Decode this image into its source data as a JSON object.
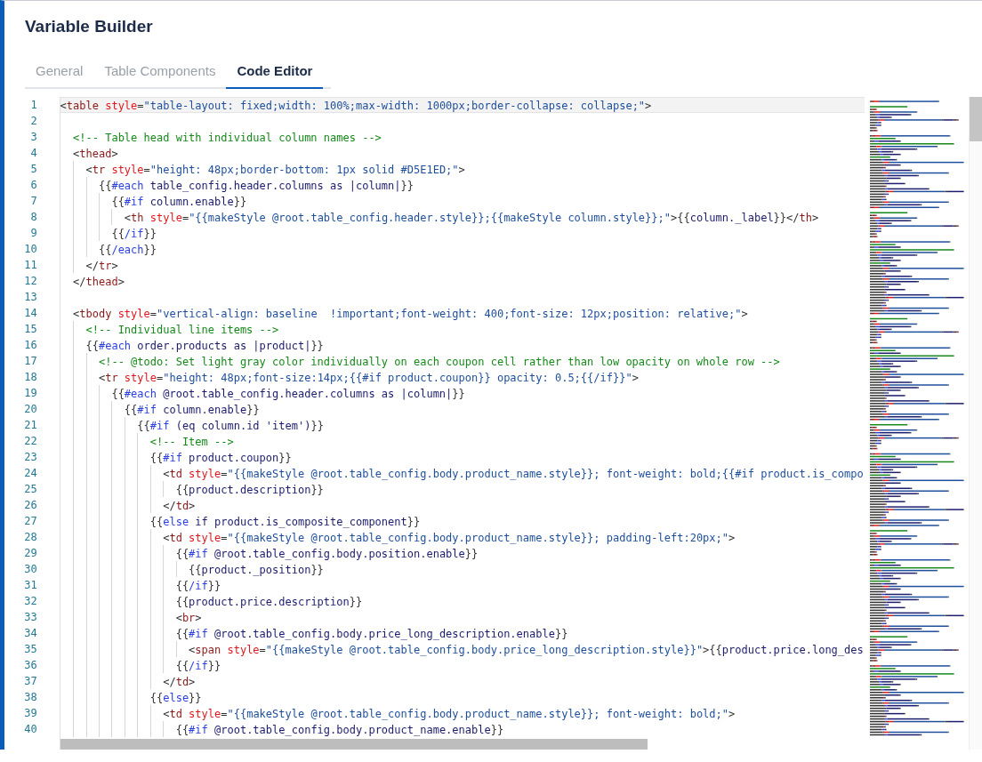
{
  "title": "Variable Builder",
  "tabs": [
    {
      "label": "General",
      "selected": false
    },
    {
      "label": "Table Components",
      "selected": false
    },
    {
      "label": "Code Editor",
      "selected": true
    }
  ],
  "editor": {
    "lines": [
      {
        "number": "1",
        "current": true,
        "tokens": [
          {
            "kind": "p",
            "text": "<"
          },
          {
            "kind": "tag",
            "text": "table"
          },
          {
            "kind": "attr",
            "text": " style"
          },
          {
            "kind": "p",
            "text": "="
          },
          {
            "kind": "str",
            "text": "\"table-layout: fixed;width: 100%;max-width: 1000px;border-collapse: collapse;\""
          },
          {
            "kind": "p",
            "text": ">"
          }
        ]
      },
      {
        "number": "2",
        "current": false
      },
      {
        "number": "3",
        "current": false,
        "tokens": [
          {
            "kind": "cm",
            "text": "  <!-- Table head with individual column names -->"
          }
        ]
      },
      {
        "number": "4",
        "current": false,
        "tokens": [
          {
            "kind": "p",
            "text": "  <"
          },
          {
            "kind": "tag",
            "text": "thead"
          },
          {
            "kind": "p",
            "text": ">"
          }
        ]
      },
      {
        "number": "5",
        "current": false,
        "tokens": [
          {
            "kind": "p",
            "text": "    <"
          },
          {
            "kind": "tag",
            "text": "tr"
          },
          {
            "kind": "attr",
            "text": " style"
          },
          {
            "kind": "p",
            "text": "="
          },
          {
            "kind": "str",
            "text": "\"height: 48px;border-bottom: 1px solid #D5E1ED;\""
          },
          {
            "kind": "p",
            "text": ">"
          }
        ]
      },
      {
        "number": "6",
        "current": false,
        "tokens": [
          {
            "kind": "p",
            "text": "      {{"
          },
          {
            "kind": "kw",
            "text": "#each"
          },
          {
            "kind": "hb",
            "text": " table_config.header.columns as |column|"
          },
          {
            "kind": "p",
            "text": "}}"
          }
        ]
      },
      {
        "number": "7",
        "current": false,
        "tokens": [
          {
            "kind": "p",
            "text": "        {{"
          },
          {
            "kind": "kw",
            "text": "#if"
          },
          {
            "kind": "hb",
            "text": " column.enable"
          },
          {
            "kind": "p",
            "text": "}}"
          }
        ]
      },
      {
        "number": "8",
        "current": false,
        "tokens": [
          {
            "kind": "p",
            "text": "          <"
          },
          {
            "kind": "tag",
            "text": "th"
          },
          {
            "kind": "attr",
            "text": " style"
          },
          {
            "kind": "p",
            "text": "="
          },
          {
            "kind": "str",
            "text": "\"{{makeStyle @root.table_config.header.style}};{{makeStyle column.style}};\""
          },
          {
            "kind": "p",
            "text": ">{{"
          },
          {
            "kind": "hb",
            "text": "column._label"
          },
          {
            "kind": "p",
            "text": "}}</"
          },
          {
            "kind": "tag",
            "text": "th"
          },
          {
            "kind": "p",
            "text": ">"
          }
        ]
      },
      {
        "number": "9",
        "current": false,
        "tokens": [
          {
            "kind": "p",
            "text": "        {{"
          },
          {
            "kind": "kw",
            "text": "/if"
          },
          {
            "kind": "p",
            "text": "}}"
          }
        ]
      },
      {
        "number": "10",
        "current": false,
        "tokens": [
          {
            "kind": "p",
            "text": "      {{"
          },
          {
            "kind": "kw",
            "text": "/each"
          },
          {
            "kind": "p",
            "text": "}}"
          }
        ]
      },
      {
        "number": "11",
        "current": false,
        "tokens": [
          {
            "kind": "p",
            "text": "    </"
          },
          {
            "kind": "tag",
            "text": "tr"
          },
          {
            "kind": "p",
            "text": ">"
          }
        ]
      },
      {
        "number": "12",
        "current": false,
        "tokens": [
          {
            "kind": "p",
            "text": "  </"
          },
          {
            "kind": "tag",
            "text": "thead"
          },
          {
            "kind": "p",
            "text": ">"
          }
        ]
      },
      {
        "number": "13",
        "current": false
      },
      {
        "number": "14",
        "current": false,
        "tokens": [
          {
            "kind": "p",
            "text": "  <"
          },
          {
            "kind": "tag",
            "text": "tbody"
          },
          {
            "kind": "attr",
            "text": " style"
          },
          {
            "kind": "p",
            "text": "="
          },
          {
            "kind": "str",
            "text": "\"vertical-align: baseline  !important;font-weight: 400;font-size: 12px;position: relative;\""
          },
          {
            "kind": "p",
            "text": ">"
          }
        ]
      },
      {
        "number": "15",
        "current": false,
        "tokens": [
          {
            "kind": "cm",
            "text": "    <!-- Individual line items -->"
          }
        ]
      },
      {
        "number": "16",
        "current": false,
        "tokens": [
          {
            "kind": "p",
            "text": "    {{"
          },
          {
            "kind": "kw",
            "text": "#each"
          },
          {
            "kind": "hb",
            "text": " order.products as |product|"
          },
          {
            "kind": "p",
            "text": "}}"
          }
        ]
      },
      {
        "number": "17",
        "current": false,
        "tokens": [
          {
            "kind": "cm",
            "text": "      <!-- @todo: Set light gray color individually on each coupon cell rather than low opacity on whole row -->"
          }
        ]
      },
      {
        "number": "18",
        "current": false,
        "tokens": [
          {
            "kind": "p",
            "text": "      <"
          },
          {
            "kind": "tag",
            "text": "tr"
          },
          {
            "kind": "attr",
            "text": " style"
          },
          {
            "kind": "p",
            "text": "="
          },
          {
            "kind": "str",
            "text": "\"height: 48px;font-size:14px;{{#if product.coupon}} opacity: 0.5;{{/if}}\""
          },
          {
            "kind": "p",
            "text": ">"
          }
        ]
      },
      {
        "number": "19",
        "current": false,
        "tokens": [
          {
            "kind": "p",
            "text": "        {{"
          },
          {
            "kind": "kw",
            "text": "#each"
          },
          {
            "kind": "hb",
            "text": " @root.table_config.header.columns as |column|"
          },
          {
            "kind": "p",
            "text": "}}"
          }
        ]
      },
      {
        "number": "20",
        "current": false,
        "tokens": [
          {
            "kind": "p",
            "text": "          {{"
          },
          {
            "kind": "kw",
            "text": "#if"
          },
          {
            "kind": "hb",
            "text": " column.enable"
          },
          {
            "kind": "p",
            "text": "}}"
          }
        ]
      },
      {
        "number": "21",
        "current": false,
        "tokens": [
          {
            "kind": "p",
            "text": "            {{"
          },
          {
            "kind": "kw",
            "text": "#if"
          },
          {
            "kind": "hb",
            "text": " (eq column.id 'item')"
          },
          {
            "kind": "p",
            "text": "}}"
          }
        ]
      },
      {
        "number": "22",
        "current": false,
        "tokens": [
          {
            "kind": "cm",
            "text": "              <!-- Item -->"
          }
        ]
      },
      {
        "number": "23",
        "current": false,
        "tokens": [
          {
            "kind": "p",
            "text": "              {{"
          },
          {
            "kind": "kw",
            "text": "#if"
          },
          {
            "kind": "hb",
            "text": " product.coupon"
          },
          {
            "kind": "p",
            "text": "}}"
          }
        ]
      },
      {
        "number": "24",
        "current": false,
        "tokens": [
          {
            "kind": "p",
            "text": "                <"
          },
          {
            "kind": "tag",
            "text": "td"
          },
          {
            "kind": "attr",
            "text": " style"
          },
          {
            "kind": "p",
            "text": "="
          },
          {
            "kind": "str",
            "text": "\"{{makeStyle @root.table_config.body.product_name.style}}; font-weight: bold;{{#if product.is_compo"
          }
        ]
      },
      {
        "number": "25",
        "current": false,
        "tokens": [
          {
            "kind": "p",
            "text": "                  {{"
          },
          {
            "kind": "hb",
            "text": "product.description"
          },
          {
            "kind": "p",
            "text": "}}"
          }
        ]
      },
      {
        "number": "26",
        "current": false,
        "tokens": [
          {
            "kind": "p",
            "text": "                </"
          },
          {
            "kind": "tag",
            "text": "td"
          },
          {
            "kind": "p",
            "text": ">"
          }
        ]
      },
      {
        "number": "27",
        "current": false,
        "tokens": [
          {
            "kind": "p",
            "text": "              {{"
          },
          {
            "kind": "kw",
            "text": "else"
          },
          {
            "kind": "hb",
            "text": " if product.is_composite_component"
          },
          {
            "kind": "p",
            "text": "}}"
          }
        ]
      },
      {
        "number": "28",
        "current": false,
        "tokens": [
          {
            "kind": "p",
            "text": "                <"
          },
          {
            "kind": "tag",
            "text": "td"
          },
          {
            "kind": "attr",
            "text": " style"
          },
          {
            "kind": "p",
            "text": "="
          },
          {
            "kind": "str",
            "text": "\"{{makeStyle @root.table_config.body.product_name.style}}; padding-left:20px;\""
          },
          {
            "kind": "p",
            "text": ">"
          }
        ]
      },
      {
        "number": "29",
        "current": false,
        "tokens": [
          {
            "kind": "p",
            "text": "                  {{"
          },
          {
            "kind": "kw",
            "text": "#if"
          },
          {
            "kind": "hb",
            "text": " @root.table_config.body.position.enable"
          },
          {
            "kind": "p",
            "text": "}}"
          }
        ]
      },
      {
        "number": "30",
        "current": false,
        "tokens": [
          {
            "kind": "p",
            "text": "                    {{"
          },
          {
            "kind": "hb",
            "text": "product._position"
          },
          {
            "kind": "p",
            "text": "}}"
          }
        ]
      },
      {
        "number": "31",
        "current": false,
        "tokens": [
          {
            "kind": "p",
            "text": "                  {{"
          },
          {
            "kind": "kw",
            "text": "/if"
          },
          {
            "kind": "p",
            "text": "}}"
          }
        ]
      },
      {
        "number": "32",
        "current": false,
        "tokens": [
          {
            "kind": "p",
            "text": "                  {{"
          },
          {
            "kind": "hb",
            "text": "product.price.description"
          },
          {
            "kind": "p",
            "text": "}}"
          }
        ]
      },
      {
        "number": "33",
        "current": false,
        "tokens": [
          {
            "kind": "p",
            "text": "                  <"
          },
          {
            "kind": "tag",
            "text": "br"
          },
          {
            "kind": "p",
            "text": ">"
          }
        ]
      },
      {
        "number": "34",
        "current": false,
        "tokens": [
          {
            "kind": "p",
            "text": "                  {{"
          },
          {
            "kind": "kw",
            "text": "#if"
          },
          {
            "kind": "hb",
            "text": " @root.table_config.body.price_long_description.enable"
          },
          {
            "kind": "p",
            "text": "}}"
          }
        ]
      },
      {
        "number": "35",
        "current": false,
        "tokens": [
          {
            "kind": "p",
            "text": "                    <"
          },
          {
            "kind": "tag",
            "text": "span"
          },
          {
            "kind": "attr",
            "text": " style"
          },
          {
            "kind": "p",
            "text": "="
          },
          {
            "kind": "str",
            "text": "\"{{makeStyle @root.table_config.body.price_long_description.style}}\""
          },
          {
            "kind": "p",
            "text": ">{{"
          },
          {
            "kind": "hb",
            "text": "product.price.long_des"
          }
        ]
      },
      {
        "number": "36",
        "current": false,
        "tokens": [
          {
            "kind": "p",
            "text": "                  {{"
          },
          {
            "kind": "kw",
            "text": "/if"
          },
          {
            "kind": "p",
            "text": "}}"
          }
        ]
      },
      {
        "number": "37",
        "current": false,
        "tokens": [
          {
            "kind": "p",
            "text": "                </"
          },
          {
            "kind": "tag",
            "text": "td"
          },
          {
            "kind": "p",
            "text": ">"
          }
        ]
      },
      {
        "number": "38",
        "current": false,
        "tokens": [
          {
            "kind": "p",
            "text": "              {{"
          },
          {
            "kind": "kw",
            "text": "else"
          },
          {
            "kind": "p",
            "text": "}}"
          }
        ]
      },
      {
        "number": "39",
        "current": false,
        "tokens": [
          {
            "kind": "p",
            "text": "                <"
          },
          {
            "kind": "tag",
            "text": "td"
          },
          {
            "kind": "attr",
            "text": " style"
          },
          {
            "kind": "p",
            "text": "="
          },
          {
            "kind": "str",
            "text": "\"{{makeStyle @root.table_config.body.product_name.style}}; font-weight: bold;\""
          },
          {
            "kind": "p",
            "text": ">"
          }
        ]
      },
      {
        "number": "40",
        "current": false,
        "tokens": [
          {
            "kind": "p",
            "text": "                  {{"
          },
          {
            "kind": "kw",
            "text": "#if"
          },
          {
            "kind": "hb",
            "text": " @root.table_config.body.product_name.enable"
          },
          {
            "kind": "p",
            "text": "}}"
          }
        ]
      }
    ]
  }
}
